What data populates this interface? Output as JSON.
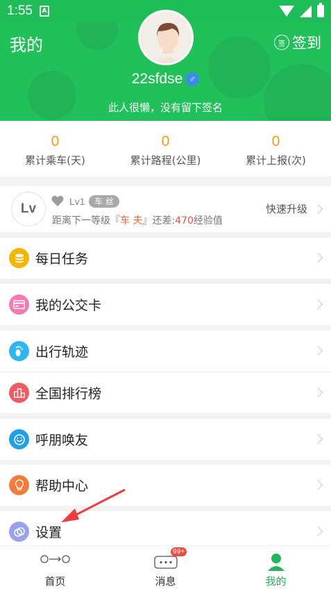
{
  "status_bar": {
    "time": "1:55",
    "sim_label": "A"
  },
  "header": {
    "title": "我的",
    "signin_label": "签到",
    "signin_icon_text": "签",
    "username": "22sfdse",
    "gender_symbol": "♂",
    "signature": "此人很懒，没有留下签名"
  },
  "stats": [
    {
      "value": "0",
      "label": "累计乘车(天)"
    },
    {
      "value": "0",
      "label": "累计路程(公里)"
    },
    {
      "value": "0",
      "label": "累计上报(次)"
    }
  ],
  "level": {
    "circle_text": "Lv",
    "level_text": "Lv1",
    "badge": "车 丝",
    "progress_prefix": "距离下一等级『",
    "next_level": "车 夫",
    "progress_mid": "』还差:",
    "points_needed": "470",
    "progress_suffix": "经验值",
    "upgrade_label": "快速升级"
  },
  "menu": [
    {
      "label": "每日任务",
      "icon": "coins-icon",
      "color": "#f5b400"
    },
    {
      "label": "我的公交卡",
      "icon": "card-icon",
      "color": "#f47ab0"
    },
    {
      "label": "出行轨迹",
      "icon": "footprint-icon",
      "color": "#2fb6ef"
    },
    {
      "label": "全国排行榜",
      "icon": "ranking-icon",
      "color": "#f05a62"
    },
    {
      "label": "呼朋唤友",
      "icon": "smile-icon",
      "color": "#1e9fe8"
    },
    {
      "label": "帮助中心",
      "icon": "lightbulb-icon",
      "color": "#f57b3a"
    },
    {
      "label": "设置",
      "icon": "settings-icon",
      "color": "#9aa2f0"
    }
  ],
  "tabs": [
    {
      "label": "首页",
      "icon": "home-route-icon"
    },
    {
      "label": "消息",
      "icon": "message-icon",
      "badge": "99+"
    },
    {
      "label": "我的",
      "icon": "profile-icon",
      "active": true
    }
  ],
  "colors": {
    "brand_green": "#22c05b",
    "stat_orange": "#f39a1e",
    "arrow_red": "#ef3b3b"
  }
}
